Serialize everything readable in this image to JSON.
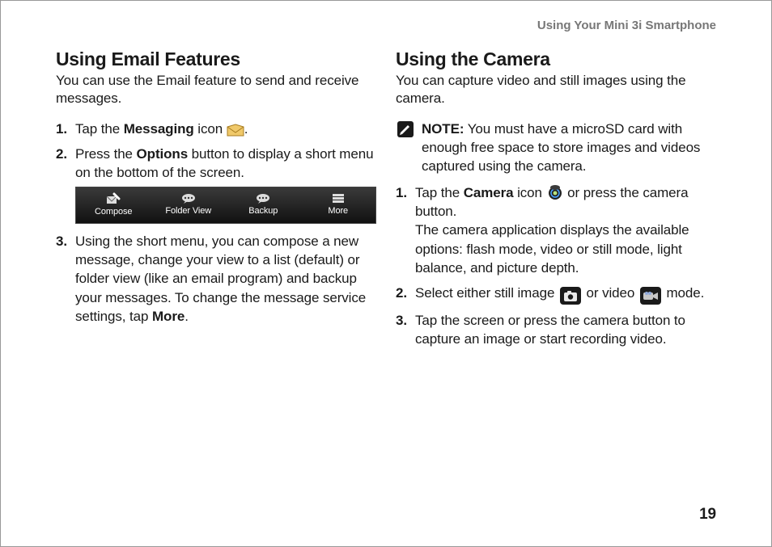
{
  "running_head": "Using Your Mini 3i Smartphone",
  "page_number": "19",
  "left": {
    "heading": "Using Email Features",
    "lead": "You can use the Email feature to send and receive messages.",
    "steps": {
      "s1_a": "Tap the ",
      "s1_bold": "Messaging",
      "s1_b": " icon ",
      "s1_c": ".",
      "s2_a": "Press the ",
      "s2_bold": "Options",
      "s2_b": " button to display a short menu on the bottom of the screen.",
      "s3_a": "Using the short menu, you can compose a new message, change your view to a list (default) or folder view (like an email program) and backup your messages. To change the message service settings, tap ",
      "s3_bold": "More",
      "s3_b": "."
    },
    "phone_menu": [
      "Compose",
      "Folder View",
      "Backup",
      "More"
    ]
  },
  "right": {
    "heading": "Using the Camera",
    "lead": "You can capture video and still images using the camera.",
    "note_bold": "NOTE:",
    "note_body": " You must have a microSD card with enough free space to store images and videos captured using the camera.",
    "steps": {
      "s1_a": "Tap the ",
      "s1_bold": "Camera",
      "s1_b": " icon ",
      "s1_c": " or press the camera button.",
      "s1_d": "The camera application displays the available options: flash mode, video or still mode, light balance, and picture depth.",
      "s2_a": "Select either still image ",
      "s2_b": " or video ",
      "s2_c": " mode.",
      "s3": "Tap the screen or press the camera button to capture an image or start recording video."
    }
  }
}
